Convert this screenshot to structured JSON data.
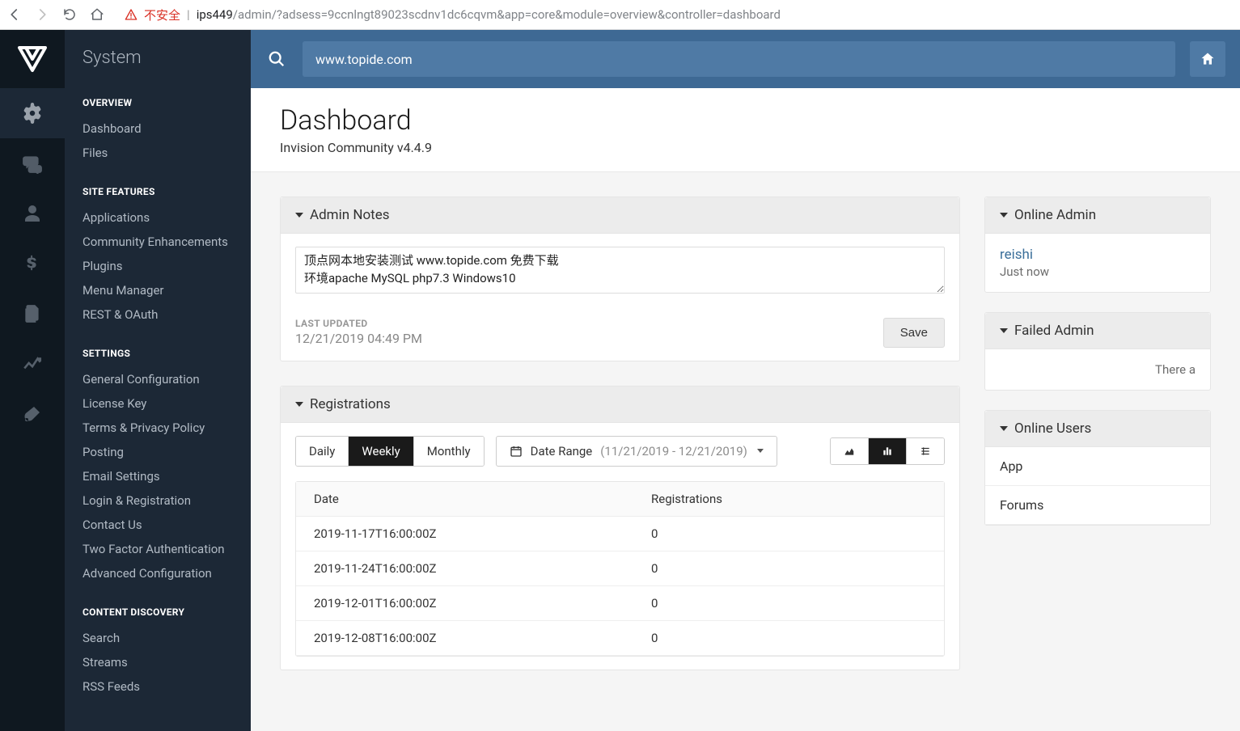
{
  "browser": {
    "insecure_label": "不安全",
    "url_host": "ips449",
    "url_path": "/admin/?adsess=9ccnlngt89023scdnv1dc6cqvm&app=core&module=overview&controller=dashboard"
  },
  "sidebar": {
    "title": "System",
    "groups": [
      {
        "heading": "OVERVIEW",
        "items": [
          "Dashboard",
          "Files"
        ]
      },
      {
        "heading": "SITE FEATURES",
        "items": [
          "Applications",
          "Community Enhancements",
          "Plugins",
          "Menu Manager",
          "REST & OAuth"
        ]
      },
      {
        "heading": "SETTINGS",
        "items": [
          "General Configuration",
          "License Key",
          "Terms & Privacy Policy",
          "Posting",
          "Email Settings",
          "Login & Registration",
          "Contact Us",
          "Two Factor Authentication",
          "Advanced Configuration"
        ]
      },
      {
        "heading": "CONTENT DISCOVERY",
        "items": [
          "Search",
          "Streams",
          "RSS Feeds"
        ]
      }
    ]
  },
  "topbar": {
    "search_value": "www.topide.com"
  },
  "page": {
    "title": "Dashboard",
    "subtitle": "Invision Community v4.4.9"
  },
  "admin_notes": {
    "title": "Admin Notes",
    "text": "顶点网本地安装测试 www.topide.com 免费下载\n环境apache MySQL php7.3 Windows10",
    "last_updated_label": "LAST UPDATED",
    "last_updated": "12/21/2019 04:49 PM",
    "save_label": "Save"
  },
  "registrations": {
    "title": "Registrations",
    "tabs": {
      "daily": "Daily",
      "weekly": "Weekly",
      "monthly": "Monthly",
      "active": "weekly"
    },
    "date_range_label": "Date Range",
    "date_range_value": "(11/21/2019 - 12/21/2019)",
    "columns": {
      "date": "Date",
      "value": "Registrations"
    },
    "rows": [
      {
        "date": "2019-11-17T16:00:00Z",
        "value": "0"
      },
      {
        "date": "2019-11-24T16:00:00Z",
        "value": "0"
      },
      {
        "date": "2019-12-01T16:00:00Z",
        "value": "0"
      },
      {
        "date": "2019-12-08T16:00:00Z",
        "value": "0"
      }
    ]
  },
  "chart_data": {
    "type": "table",
    "title": "Registrations",
    "xlabel": "Date",
    "ylabel": "Registrations",
    "categories": [
      "2019-11-17T16:00:00Z",
      "2019-11-24T16:00:00Z",
      "2019-12-01T16:00:00Z",
      "2019-12-08T16:00:00Z"
    ],
    "values": [
      0,
      0,
      0,
      0
    ]
  },
  "online_admins": {
    "title": "Online Admin",
    "user": "reishi",
    "meta": "Just now"
  },
  "failed_admin": {
    "title": "Failed Admin",
    "empty": "There a"
  },
  "online_users": {
    "title": "Online Users",
    "rows": [
      "App",
      "Forums"
    ]
  }
}
